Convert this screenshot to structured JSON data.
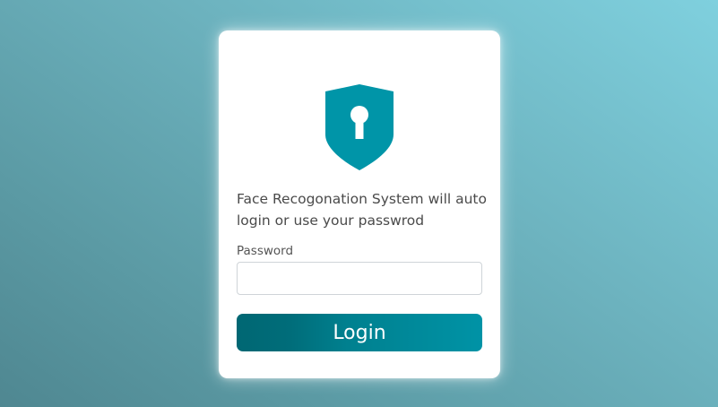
{
  "login_card": {
    "icon": "shield-keyhole-icon",
    "message": "Face Recogonation System will auto login or use your passwrod",
    "password_label": "Password",
    "password_value": "",
    "password_placeholder": "",
    "login_label": "Login"
  },
  "colors": {
    "accent": "#0095a8",
    "button_gradient_start": "#006773",
    "button_gradient_end": "#0093a6",
    "background_light": "#7fd0de",
    "background_dark": "#4f8791"
  }
}
